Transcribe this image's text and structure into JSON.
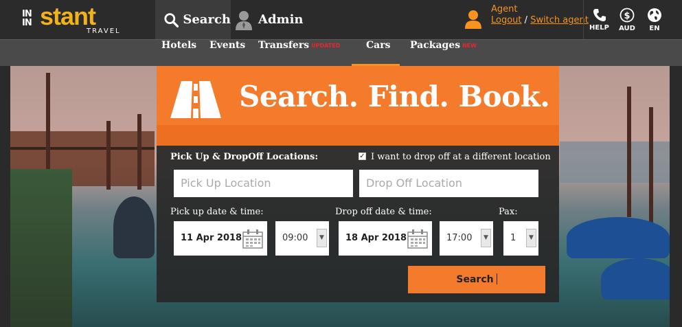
{
  "brand": {
    "logo_in": "IN\nIN",
    "logo_stant": "stant",
    "logo_sub": "TRAVEL"
  },
  "topnav": {
    "search_label": "Search",
    "admin_label": "Admin"
  },
  "agent": {
    "name": "Agent",
    "logout": "Logout",
    "separator": "/",
    "switch": "Switch agent"
  },
  "utilities": {
    "help": "HELP",
    "currency": "AUD",
    "language": "EN"
  },
  "subnav": {
    "items": [
      {
        "label": "Hotels",
        "badge": ""
      },
      {
        "label": "Events",
        "badge": ""
      },
      {
        "label": "Transfers",
        "badge": "UPDATED"
      },
      {
        "label": "Cars",
        "badge": ""
      },
      {
        "label": "Packages",
        "badge": "NEW"
      }
    ],
    "active": "Cars"
  },
  "hero": {
    "headline": "Search. Find. Book."
  },
  "form": {
    "locations_label": "Pick Up & DropOff Locations:",
    "different_location_label": "I want to drop off at a different location",
    "different_location_checked": true,
    "pickup_placeholder": "Pick Up Location",
    "dropoff_placeholder": "Drop Off Location",
    "pickup_datetime_label": "Pick up date & time:",
    "dropoff_datetime_label": "Drop off date & time:",
    "pax_label": "Pax:",
    "pickup_date": "11 Apr 2018",
    "pickup_time": "09:00",
    "dropoff_date": "18 Apr 2018",
    "dropoff_time": "17:00",
    "pax": "1",
    "search_button": "Search"
  },
  "colors": {
    "accent_orange": "#f47a2c",
    "agent_orange": "#f7931e",
    "logo_yellow": "#f2b21b",
    "badge_red": "#e8262e",
    "topbar": "#2b2b2b",
    "subnav": "#4a4a4a"
  }
}
